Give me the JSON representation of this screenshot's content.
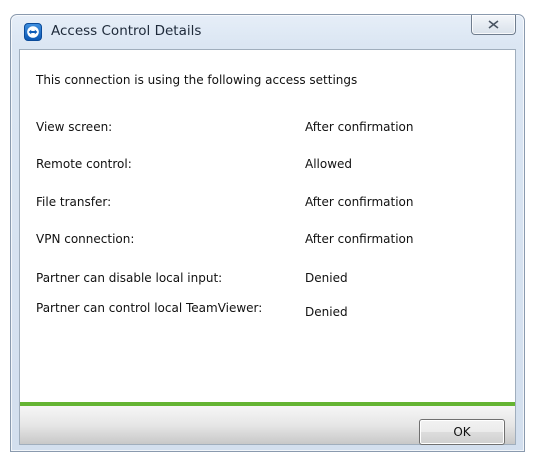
{
  "window": {
    "title": "Access Control Details",
    "close_icon": "close-icon",
    "app_icon": "teamviewer-app-icon"
  },
  "content": {
    "intro": "This connection is using the following access settings",
    "settings": [
      {
        "label": "View screen:",
        "value": "After confirmation"
      },
      {
        "label": "Remote control:",
        "value": "Allowed"
      },
      {
        "label": "File transfer:",
        "value": "After confirmation"
      },
      {
        "label": "VPN connection:",
        "value": "After confirmation"
      },
      {
        "label": "Partner can disable local input:",
        "value": "Denied"
      },
      {
        "label": "Partner can control local TeamViewer:",
        "value": "Denied"
      }
    ]
  },
  "footer": {
    "ok_label": "OK",
    "accent_color": "#64b432"
  }
}
